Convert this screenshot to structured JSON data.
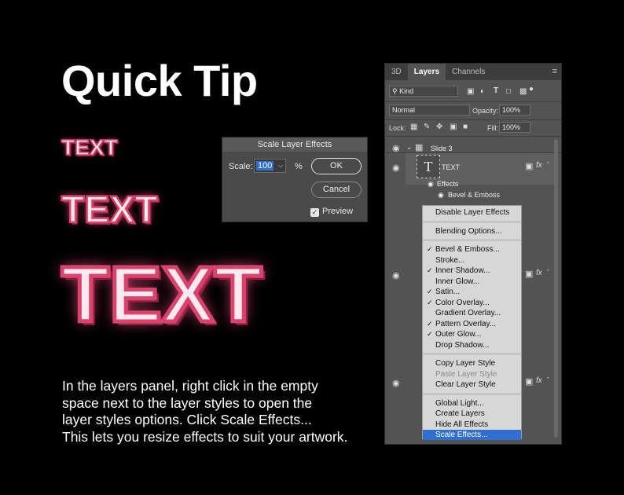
{
  "title": "Quick Tip",
  "samples": [
    "TEXT",
    "TEXT",
    "TEXT"
  ],
  "description": [
    "In the layers panel, right click in the empty",
    "space next to the layer styles to open the",
    "layer styles options. Click Scale Effects...",
    "This lets you resize effects to suit your artwork."
  ],
  "dialog": {
    "title": "Scale Layer Effects",
    "scale_label": "Scale:",
    "scale_value": "100",
    "unit": "%",
    "ok": "OK",
    "cancel": "Cancel",
    "preview": "Preview",
    "preview_checked": true
  },
  "panel": {
    "tabs": [
      "3D",
      "Layers",
      "Channels"
    ],
    "active_tab": "Layers",
    "kind": "Kind",
    "blend_mode": "Normal",
    "opacity_label": "Opacity:",
    "opacity_value": "100%",
    "lock_label": "Lock:",
    "fill_label": "Fill:",
    "fill_value": "100%",
    "group_name": "Slide 3",
    "layer_name": "TEXT",
    "effects_label": "Effects",
    "effect_item": "Bevel & Emboss"
  },
  "context_menu": [
    {
      "label": "Disable Layer Effects",
      "checked": false,
      "disabled": false,
      "selected": false
    },
    {
      "divider": true
    },
    {
      "label": "Blending Options...",
      "checked": false,
      "disabled": false,
      "selected": false
    },
    {
      "divider": true
    },
    {
      "label": "Bevel & Emboss...",
      "checked": true,
      "disabled": false,
      "selected": false
    },
    {
      "label": "Stroke...",
      "checked": false,
      "disabled": false,
      "selected": false
    },
    {
      "label": "Inner Shadow...",
      "checked": true,
      "disabled": false,
      "selected": false
    },
    {
      "label": "Inner Glow...",
      "checked": false,
      "disabled": false,
      "selected": false
    },
    {
      "label": "Satin...",
      "checked": true,
      "disabled": false,
      "selected": false
    },
    {
      "label": "Color Overlay...",
      "checked": true,
      "disabled": false,
      "selected": false
    },
    {
      "label": "Gradient Overlay...",
      "checked": false,
      "disabled": false,
      "selected": false
    },
    {
      "label": "Pattern Overlay...",
      "checked": true,
      "disabled": false,
      "selected": false
    },
    {
      "label": "Outer Glow...",
      "checked": true,
      "disabled": false,
      "selected": false
    },
    {
      "label": "Drop Shadow...",
      "checked": false,
      "disabled": false,
      "selected": false
    },
    {
      "divider": true
    },
    {
      "label": "Copy Layer Style",
      "checked": false,
      "disabled": false,
      "selected": false
    },
    {
      "label": "Paste Layer Style",
      "checked": false,
      "disabled": true,
      "selected": false
    },
    {
      "label": "Clear Layer Style",
      "checked": false,
      "disabled": false,
      "selected": false
    },
    {
      "divider": true
    },
    {
      "label": "Global Light...",
      "checked": false,
      "disabled": false,
      "selected": false
    },
    {
      "label": "Create Layers",
      "checked": false,
      "disabled": false,
      "selected": false
    },
    {
      "label": "Hide All Effects",
      "checked": false,
      "disabled": false,
      "selected": false
    },
    {
      "label": "Scale Effects...",
      "checked": false,
      "disabled": false,
      "selected": true
    }
  ],
  "colors": {
    "accent_blue": "#2f6fcf",
    "text_pink_fill": "#fde9ef",
    "text_pink_stroke": "#d9436c"
  }
}
